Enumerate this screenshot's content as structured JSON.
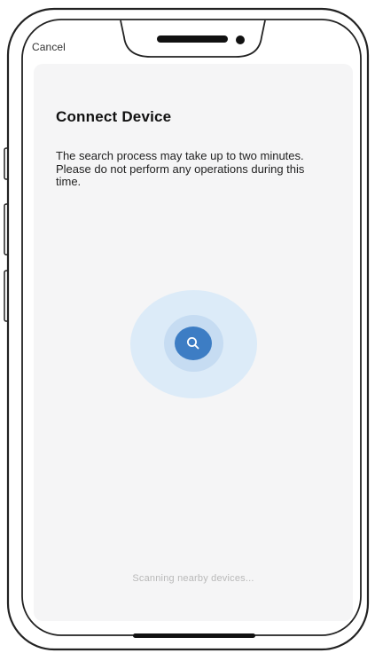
{
  "header": {
    "cancel_label": "Cancel"
  },
  "main": {
    "title": "Connect Device",
    "description": "The search process may take up to two minutes. Please do not perform any operations during this time.",
    "status": "Scanning nearby devices..."
  },
  "icons": {
    "scan_button": "search-icon"
  },
  "colors": {
    "accent": "#3d7dc4",
    "ring_outer": "#dcebf8",
    "ring_inner": "#c6dcf2",
    "screen_background": "#f5f5f6"
  }
}
